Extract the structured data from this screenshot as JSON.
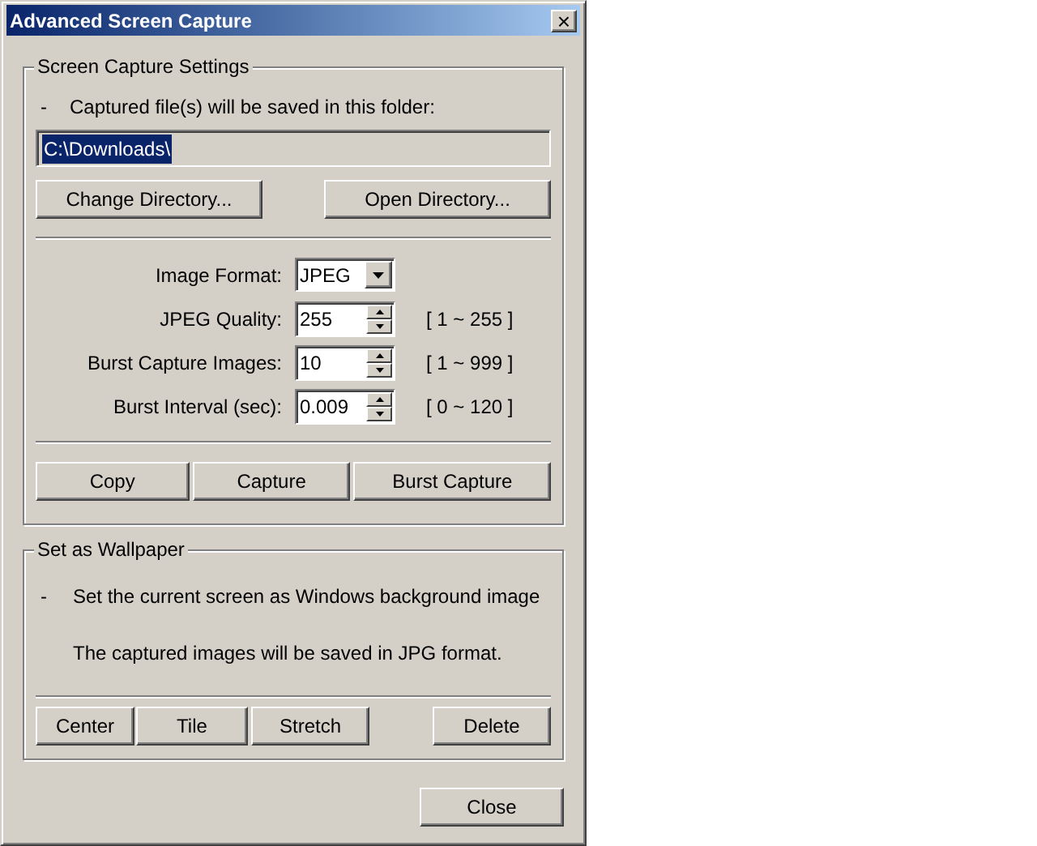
{
  "window": {
    "title": "Advanced Screen Capture",
    "close_glyph": "×"
  },
  "capture_settings": {
    "title": "Screen Capture Settings",
    "bullet": "-",
    "note": "Captured file(s) will be saved in this folder:",
    "folder": {
      "value": "C:\\Downloads\\",
      "text_selected": true
    },
    "folder_buttons": [
      "Change Directory...",
      "Open Directory..."
    ],
    "options": [
      {
        "kind": "dropdown",
        "label": "Image Format:",
        "value": "JPEG"
      },
      {
        "kind": "spinner",
        "label": "JPEG Quality:",
        "value": "255",
        "range": "[ 1 ~ 255 ]"
      },
      {
        "kind": "spinner",
        "label": "Burst Capture Images:",
        "value": "10",
        "range": "[ 1 ~ 999 ]"
      },
      {
        "kind": "spinner",
        "label": "Burst Interval (sec):",
        "value": "0.009",
        "range": "[ 0 ~ 120 ]"
      }
    ],
    "action_buttons": [
      "Copy",
      "Capture",
      "Burst Capture"
    ]
  },
  "wallpaper": {
    "title": "Set as Wallpaper",
    "bullet": "-",
    "note": "Set the current screen as Windows background image",
    "info": "The captured images will be saved in JPG format.",
    "buttons": [
      "Center",
      "Tile",
      "Stretch",
      "Delete"
    ]
  },
  "close_button": "Close"
}
